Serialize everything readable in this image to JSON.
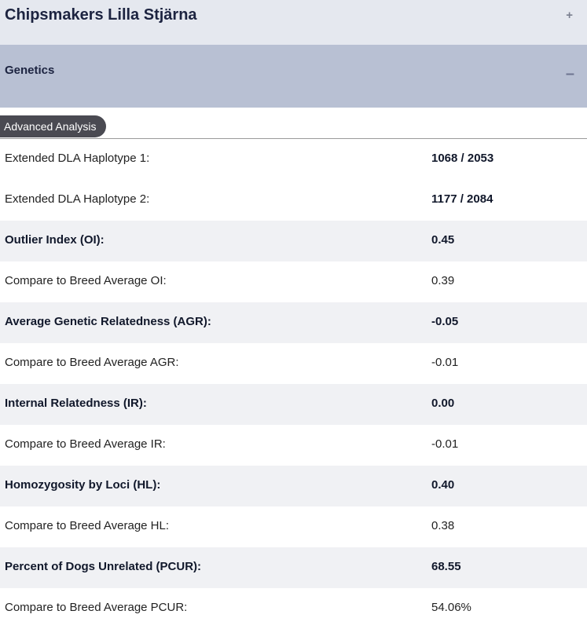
{
  "header": {
    "title": "Chipsmakers Lilla Stjärna",
    "toggle": "+"
  },
  "section": {
    "title": "Genetics",
    "toggle": "–"
  },
  "advanced_tab": "Advanced Analysis",
  "rows": [
    {
      "label": "Extended DLA Haplotype 1:",
      "value": "1068 / 2053"
    },
    {
      "label": "Extended DLA Haplotype 2:",
      "value": "1177 / 2084"
    },
    {
      "label": "Outlier Index (OI):",
      "value": "0.45"
    },
    {
      "label": "Compare to Breed Average OI:",
      "value": "0.39"
    },
    {
      "label": "Average Genetic Relatedness (AGR):",
      "value": "-0.05"
    },
    {
      "label": "Compare to Breed Average AGR:",
      "value": "-0.01"
    },
    {
      "label": "Internal Relatedness (IR):",
      "value": "0.00"
    },
    {
      "label": "Compare to Breed Average IR:",
      "value": "-0.01"
    },
    {
      "label": "Homozygosity by Loci (HL):",
      "value": "0.40"
    },
    {
      "label": "Compare to Breed Average HL:",
      "value": "0.38"
    },
    {
      "label": "Percent of Dogs Unrelated (PCUR):",
      "value": "68.55"
    },
    {
      "label": "Compare to Breed Average PCUR:",
      "value": "54.06%"
    }
  ]
}
